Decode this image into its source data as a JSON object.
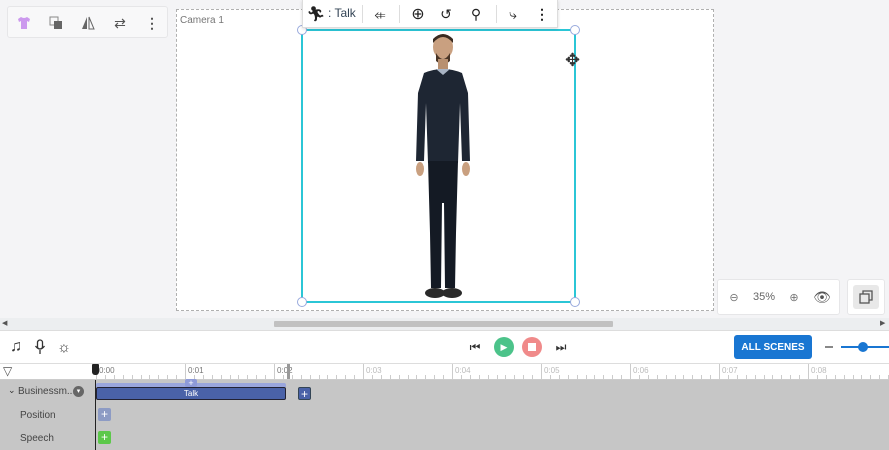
{
  "left_toolbar": {
    "icons": [
      "shirt-icon",
      "layers-icon",
      "flip-icon",
      "swap-icon",
      "more-vertical-icon"
    ]
  },
  "stage": {
    "camera_label": "Camera 1"
  },
  "context_toolbar": {
    "action_label": ": Talk"
  },
  "zoom": {
    "level": "35%"
  },
  "timeline": {
    "all_scenes_label": "ALL SCENES",
    "ruler_labels": [
      "0:00",
      "0:01",
      "0:02",
      "0:03",
      "0:04",
      "0:05",
      "0:06",
      "0:07",
      "0:08"
    ],
    "tracks": [
      {
        "label": "Businessm..."
      },
      {
        "label": "Position"
      },
      {
        "label": "Speech"
      }
    ],
    "clip_label": "Talk"
  },
  "colors": {
    "accent": "#1976d2",
    "selection": "#2bc6d6",
    "clip": "#4a62a8",
    "play": "#4cc38a",
    "stop": "#f08a8a",
    "speech": "#5cc84a"
  }
}
